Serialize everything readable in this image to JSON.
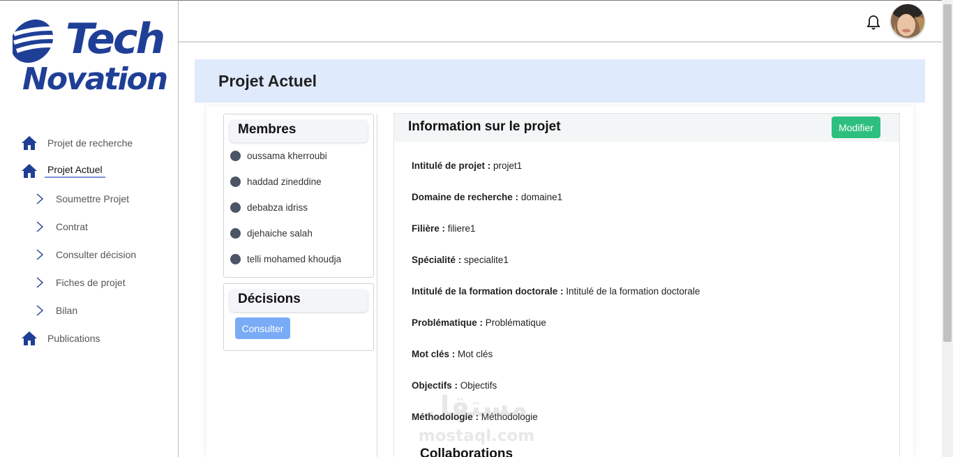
{
  "brand": {
    "line1": "Tech",
    "line2": "Novation",
    "color": "#1f3f97"
  },
  "sidebar": {
    "items": [
      {
        "label": "Projet de recherche",
        "icon": "home-icon"
      },
      {
        "label": "Projet Actuel",
        "icon": "home-icon",
        "active": true
      },
      {
        "label": "Publications",
        "icon": "home-icon"
      }
    ],
    "sub_items": [
      {
        "label": "Soumettre Projet",
        "icon": "chevron-right-icon"
      },
      {
        "label": "Contrat",
        "icon": "chevron-right-icon"
      },
      {
        "label": "Consulter décision",
        "icon": "chevron-right-icon"
      },
      {
        "label": "Fiches de projet",
        "icon": "chevron-right-icon"
      },
      {
        "label": "Bilan",
        "icon": "chevron-right-icon"
      }
    ]
  },
  "topbar": {
    "bell_icon": "bell-icon",
    "avatar": "user-avatar"
  },
  "page": {
    "title": "Projet Actuel"
  },
  "members": {
    "title": "Membres",
    "list": [
      "oussama kherroubi",
      "haddad zineddine",
      "debabza idriss",
      "djehaiche salah",
      "telli mohamed khoudja"
    ]
  },
  "decisions": {
    "title": "Décisions",
    "button": "Consulter",
    "button_color": "#79abf6"
  },
  "info": {
    "title": "Information sur le projet",
    "edit_button": "Modifier",
    "edit_button_color": "#2dbf7e",
    "fields": [
      {
        "label": "Intitulé de projet :",
        "value": "projet1"
      },
      {
        "label": "Domaine de recherche :",
        "value": "domaine1"
      },
      {
        "label": "Filière :",
        "value": "filiere1"
      },
      {
        "label": "Spécialité :",
        "value": "specialite1"
      },
      {
        "label": "Intitulé de la formation doctorale :",
        "value": "Intitulé de la formation doctorale"
      },
      {
        "label": "Problématique :",
        "value": "Problématique"
      },
      {
        "label": "Mot clés :",
        "value": "Mot clés"
      },
      {
        "label": "Objectifs :",
        "value": "Objectifs"
      },
      {
        "label": "Méthodologie :",
        "value": "Méthodologie"
      }
    ],
    "collab_title": "Collaborations"
  },
  "watermark": {
    "arabic": "مستقل",
    "latin": "mostaql.com"
  }
}
